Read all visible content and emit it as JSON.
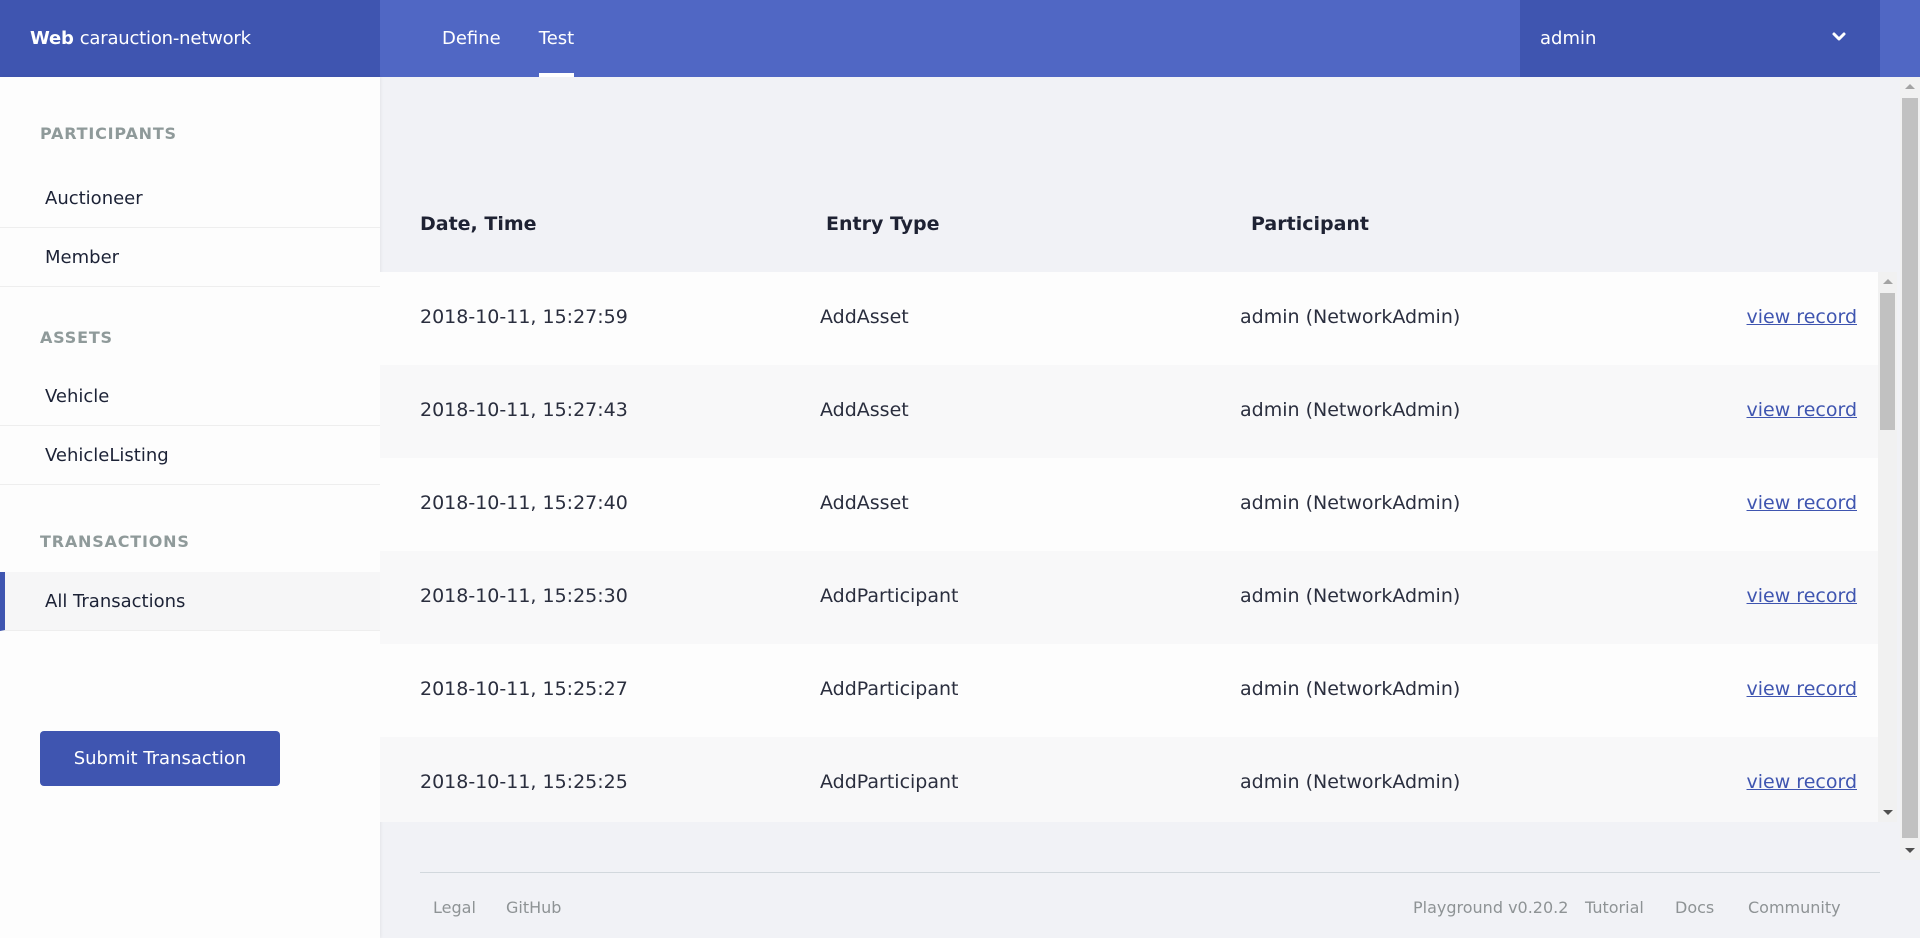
{
  "header": {
    "brand_bold": "Web",
    "brand_name": "carauction-network",
    "tabs": [
      {
        "label": "Define",
        "active": false
      },
      {
        "label": "Test",
        "active": true
      }
    ],
    "user": "admin",
    "user_dropdown_icon": "chevron-down-icon"
  },
  "sidebar": {
    "sections": [
      {
        "title": "PARTICIPANTS",
        "items": [
          "Auctioneer",
          "Member"
        ]
      },
      {
        "title": "ASSETS",
        "items": [
          "Vehicle",
          "VehicleListing"
        ]
      },
      {
        "title": "TRANSACTIONS",
        "items": [
          "All Transactions"
        ]
      }
    ],
    "active_item": "All Transactions",
    "submit_label": "Submit Transaction"
  },
  "table": {
    "columns": [
      "Date, Time",
      "Entry Type",
      "Participant"
    ],
    "rows": [
      {
        "datetime": "2018-10-11, 15:27:59",
        "type": "AddAsset",
        "participant": "admin (NetworkAdmin)",
        "link": "view record"
      },
      {
        "datetime": "2018-10-11, 15:27:43",
        "type": "AddAsset",
        "participant": "admin (NetworkAdmin)",
        "link": "view record"
      },
      {
        "datetime": "2018-10-11, 15:27:40",
        "type": "AddAsset",
        "participant": "admin (NetworkAdmin)",
        "link": "view record"
      },
      {
        "datetime": "2018-10-11, 15:25:30",
        "type": "AddParticipant",
        "participant": "admin (NetworkAdmin)",
        "link": "view record"
      },
      {
        "datetime": "2018-10-11, 15:25:27",
        "type": "AddParticipant",
        "participant": "admin (NetworkAdmin)",
        "link": "view record"
      },
      {
        "datetime": "2018-10-11, 15:25:25",
        "type": "AddParticipant",
        "participant": "admin (NetworkAdmin)",
        "link": "view record"
      }
    ]
  },
  "footer": {
    "left_links": [
      "Legal",
      "GitHub"
    ],
    "version": "Playground v0.20.2",
    "right_links": [
      "Tutorial",
      "Docs",
      "Community"
    ]
  },
  "colors": {
    "brand": "#3f55b0",
    "header": "#5067c4",
    "link": "#3f55b0"
  }
}
